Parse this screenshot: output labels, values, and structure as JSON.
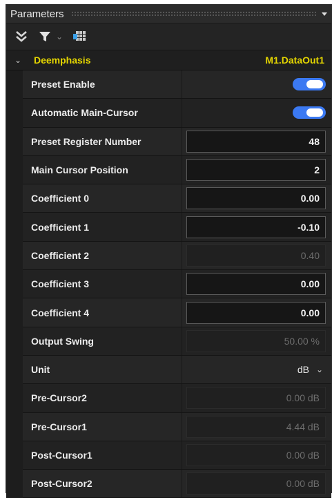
{
  "window": {
    "title": "Parameters"
  },
  "toolbar": {
    "icons": [
      "collapse-all-icon",
      "filter-icon",
      "chevron-down-icon",
      "table-layout-icon"
    ]
  },
  "group": {
    "name": "Deemphasis",
    "value": "M1.DataOut1",
    "accent": "#e5d600"
  },
  "params": [
    {
      "label": "Preset Enable",
      "kind": "toggle",
      "on": true
    },
    {
      "label": "Automatic Main-Cursor",
      "kind": "toggle",
      "on": true
    },
    {
      "label": "Preset Register Number",
      "kind": "editable",
      "value": "48"
    },
    {
      "label": "Main Cursor Position",
      "kind": "editable",
      "value": "2"
    },
    {
      "label": "Coefficient 0",
      "kind": "editable",
      "value": "0.00"
    },
    {
      "label": "Coefficient 1",
      "kind": "editable",
      "value": "-0.10"
    },
    {
      "label": "Coefficient 2",
      "kind": "readonly",
      "value": "0.40"
    },
    {
      "label": "Coefficient 3",
      "kind": "editable",
      "value": "0.00"
    },
    {
      "label": "Coefficient 4",
      "kind": "editable",
      "value": "0.00"
    },
    {
      "label": "Output Swing",
      "kind": "readonly",
      "value": "50.00 %"
    },
    {
      "label": "Unit",
      "kind": "select",
      "value": "dB"
    },
    {
      "label": "Pre-Cursor2",
      "kind": "readonly",
      "value": "0.00 dB"
    },
    {
      "label": "Pre-Cursor1",
      "kind": "readonly",
      "value": "4.44 dB"
    },
    {
      "label": "Post-Cursor1",
      "kind": "readonly",
      "value": "0.00 dB"
    },
    {
      "label": "Post-Cursor2",
      "kind": "readonly",
      "value": "0.00 dB"
    }
  ],
  "colors": {
    "toggle_on": "#3b79f2",
    "background": "#1b1b1b"
  }
}
